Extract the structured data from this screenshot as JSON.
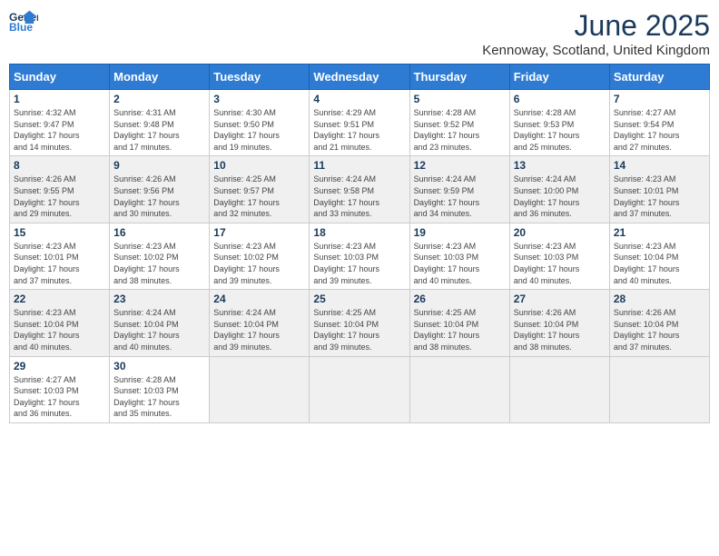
{
  "header": {
    "logo_line1": "General",
    "logo_line2": "Blue",
    "month_title": "June 2025",
    "location": "Kennoway, Scotland, United Kingdom"
  },
  "days_of_week": [
    "Sunday",
    "Monday",
    "Tuesday",
    "Wednesday",
    "Thursday",
    "Friday",
    "Saturday"
  ],
  "weeks": [
    [
      {
        "day": "1",
        "sunrise": "4:32 AM",
        "sunset": "9:47 PM",
        "daylight": "17 hours and 14 minutes."
      },
      {
        "day": "2",
        "sunrise": "4:31 AM",
        "sunset": "9:48 PM",
        "daylight": "17 hours and 17 minutes."
      },
      {
        "day": "3",
        "sunrise": "4:30 AM",
        "sunset": "9:50 PM",
        "daylight": "17 hours and 19 minutes."
      },
      {
        "day": "4",
        "sunrise": "4:29 AM",
        "sunset": "9:51 PM",
        "daylight": "17 hours and 21 minutes."
      },
      {
        "day": "5",
        "sunrise": "4:28 AM",
        "sunset": "9:52 PM",
        "daylight": "17 hours and 23 minutes."
      },
      {
        "day": "6",
        "sunrise": "4:28 AM",
        "sunset": "9:53 PM",
        "daylight": "17 hours and 25 minutes."
      },
      {
        "day": "7",
        "sunrise": "4:27 AM",
        "sunset": "9:54 PM",
        "daylight": "17 hours and 27 minutes."
      }
    ],
    [
      {
        "day": "8",
        "sunrise": "4:26 AM",
        "sunset": "9:55 PM",
        "daylight": "17 hours and 29 minutes."
      },
      {
        "day": "9",
        "sunrise": "4:26 AM",
        "sunset": "9:56 PM",
        "daylight": "17 hours and 30 minutes."
      },
      {
        "day": "10",
        "sunrise": "4:25 AM",
        "sunset": "9:57 PM",
        "daylight": "17 hours and 32 minutes."
      },
      {
        "day": "11",
        "sunrise": "4:24 AM",
        "sunset": "9:58 PM",
        "daylight": "17 hours and 33 minutes."
      },
      {
        "day": "12",
        "sunrise": "4:24 AM",
        "sunset": "9:59 PM",
        "daylight": "17 hours and 34 minutes."
      },
      {
        "day": "13",
        "sunrise": "4:24 AM",
        "sunset": "10:00 PM",
        "daylight": "17 hours and 36 minutes."
      },
      {
        "day": "14",
        "sunrise": "4:23 AM",
        "sunset": "10:01 PM",
        "daylight": "17 hours and 37 minutes."
      }
    ],
    [
      {
        "day": "15",
        "sunrise": "4:23 AM",
        "sunset": "10:01 PM",
        "daylight": "17 hours and 37 minutes."
      },
      {
        "day": "16",
        "sunrise": "4:23 AM",
        "sunset": "10:02 PM",
        "daylight": "17 hours and 38 minutes."
      },
      {
        "day": "17",
        "sunrise": "4:23 AM",
        "sunset": "10:02 PM",
        "daylight": "17 hours and 39 minutes."
      },
      {
        "day": "18",
        "sunrise": "4:23 AM",
        "sunset": "10:03 PM",
        "daylight": "17 hours and 39 minutes."
      },
      {
        "day": "19",
        "sunrise": "4:23 AM",
        "sunset": "10:03 PM",
        "daylight": "17 hours and 40 minutes."
      },
      {
        "day": "20",
        "sunrise": "4:23 AM",
        "sunset": "10:03 PM",
        "daylight": "17 hours and 40 minutes."
      },
      {
        "day": "21",
        "sunrise": "4:23 AM",
        "sunset": "10:04 PM",
        "daylight": "17 hours and 40 minutes."
      }
    ],
    [
      {
        "day": "22",
        "sunrise": "4:23 AM",
        "sunset": "10:04 PM",
        "daylight": "17 hours and 40 minutes."
      },
      {
        "day": "23",
        "sunrise": "4:24 AM",
        "sunset": "10:04 PM",
        "daylight": "17 hours and 40 minutes."
      },
      {
        "day": "24",
        "sunrise": "4:24 AM",
        "sunset": "10:04 PM",
        "daylight": "17 hours and 39 minutes."
      },
      {
        "day": "25",
        "sunrise": "4:25 AM",
        "sunset": "10:04 PM",
        "daylight": "17 hours and 39 minutes."
      },
      {
        "day": "26",
        "sunrise": "4:25 AM",
        "sunset": "10:04 PM",
        "daylight": "17 hours and 38 minutes."
      },
      {
        "day": "27",
        "sunrise": "4:26 AM",
        "sunset": "10:04 PM",
        "daylight": "17 hours and 38 minutes."
      },
      {
        "day": "28",
        "sunrise": "4:26 AM",
        "sunset": "10:04 PM",
        "daylight": "17 hours and 37 minutes."
      }
    ],
    [
      {
        "day": "29",
        "sunrise": "4:27 AM",
        "sunset": "10:03 PM",
        "daylight": "17 hours and 36 minutes."
      },
      {
        "day": "30",
        "sunrise": "4:28 AM",
        "sunset": "10:03 PM",
        "daylight": "17 hours and 35 minutes."
      },
      null,
      null,
      null,
      null,
      null
    ]
  ],
  "labels": {
    "sunrise": "Sunrise:",
    "sunset": "Sunset:",
    "daylight": "Daylight:"
  }
}
